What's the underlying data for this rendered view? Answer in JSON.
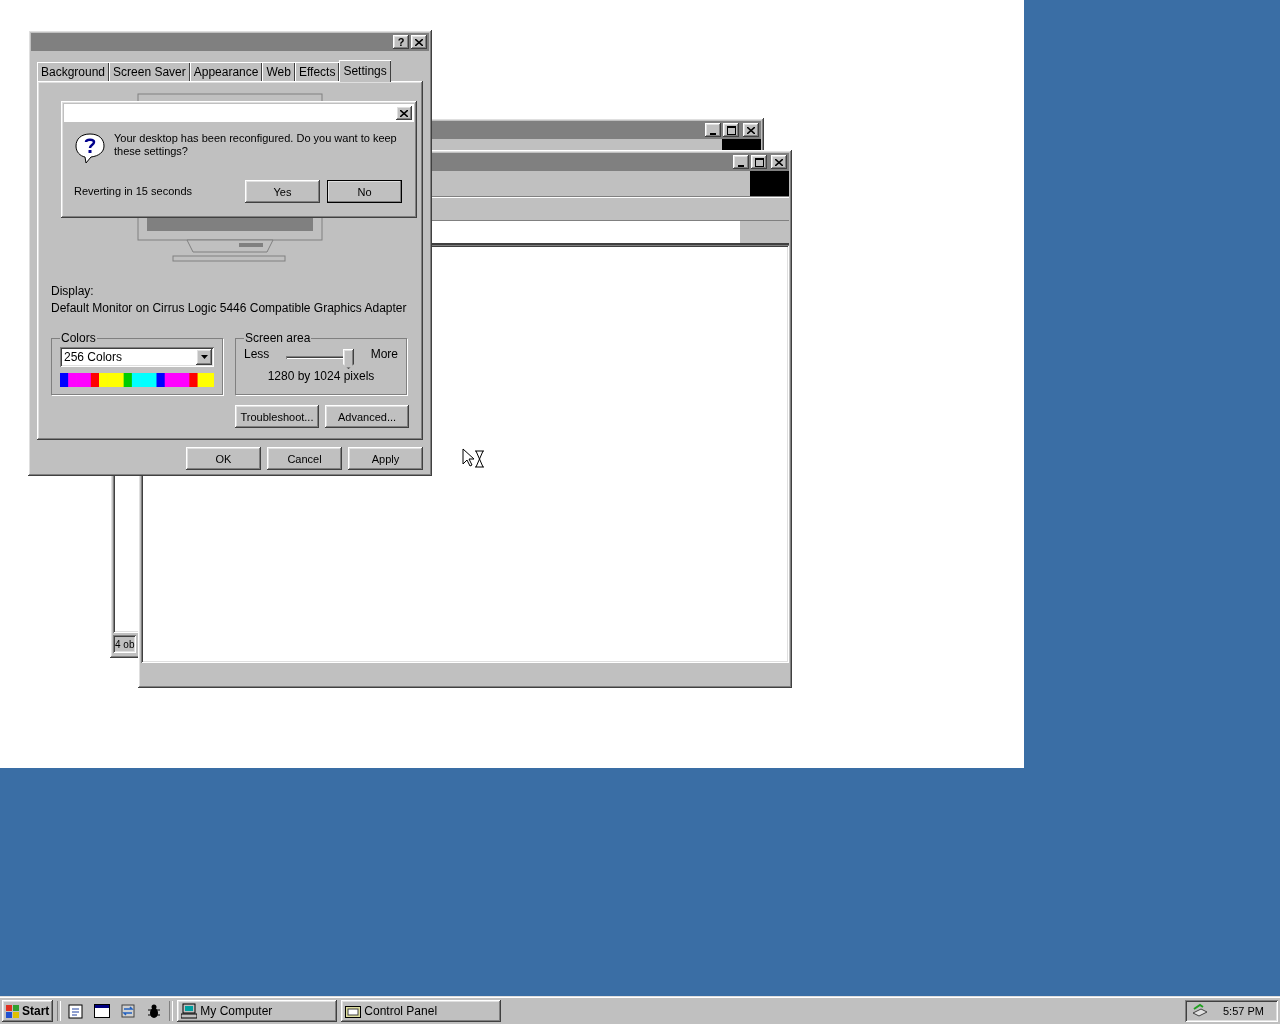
{
  "display_properties": {
    "help_button": "?",
    "tabs": [
      {
        "label": "Background",
        "selected": false
      },
      {
        "label": "Screen Saver",
        "selected": false
      },
      {
        "label": "Appearance",
        "selected": false
      },
      {
        "label": "Web",
        "selected": false
      },
      {
        "label": "Effects",
        "selected": false
      },
      {
        "label": "Settings",
        "selected": true
      }
    ],
    "display_label": "Display:",
    "display_value": "Default Monitor on Cirrus Logic 5446 Compatible Graphics Adapter",
    "colors": {
      "title": "Colors",
      "value": "256 Colors"
    },
    "screen_area": {
      "title": "Screen area",
      "less": "Less",
      "more": "More",
      "level": 1,
      "reading": "1280 by 1024 pixels"
    },
    "buttons": [
      "Troubleshoot...",
      "Advanced..."
    ],
    "footer_buttons": [
      "OK",
      "Cancel",
      "Apply"
    ]
  },
  "confirm_dialog": {
    "message": "Your desktop has been reconfigured.  Do you want to keep these settings?",
    "countdown": "Reverting in 15 seconds",
    "buttons": [
      {
        "label": "Yes",
        "default": false
      },
      {
        "label": "No",
        "default": true
      }
    ]
  },
  "background_window": {
    "status": "4 ob"
  },
  "taskbar": {
    "start": "Start",
    "tasks": [
      {
        "label": "My Computer",
        "selected": false
      },
      {
        "label": "Control Panel",
        "selected": false
      }
    ],
    "clock": "5:57 PM"
  }
}
